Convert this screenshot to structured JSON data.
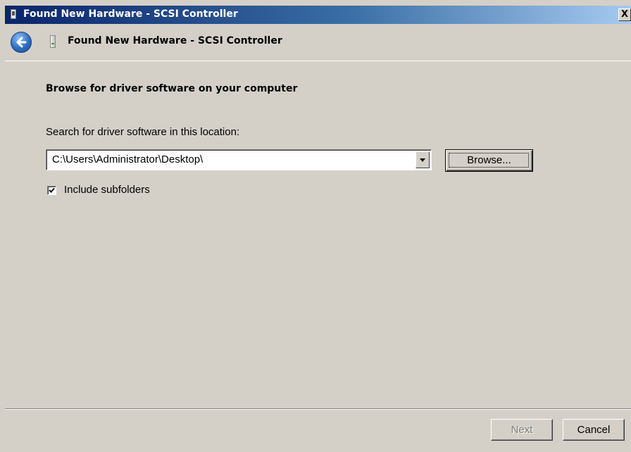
{
  "window": {
    "title": "Found New Hardware - SCSI Controller",
    "close_glyph": "X"
  },
  "header": {
    "title": "Found New Hardware - SCSI Controller"
  },
  "content": {
    "heading": "Browse for driver software on your computer",
    "search_label": "Search for driver software in this location:",
    "path_value": "C:\\Users\\Administrator\\Desktop\\",
    "browse_label": "Browse...",
    "include_subfolders_label": "Include subfolders",
    "include_subfolders_checked": true
  },
  "footer": {
    "next_label": "Next",
    "cancel_label": "Cancel"
  },
  "colors": {
    "window_bg": "#d4d0c8",
    "titlebar_start": "#0a246a",
    "titlebar_end": "#a6caf0",
    "back_button": "#2f6fc0"
  }
}
